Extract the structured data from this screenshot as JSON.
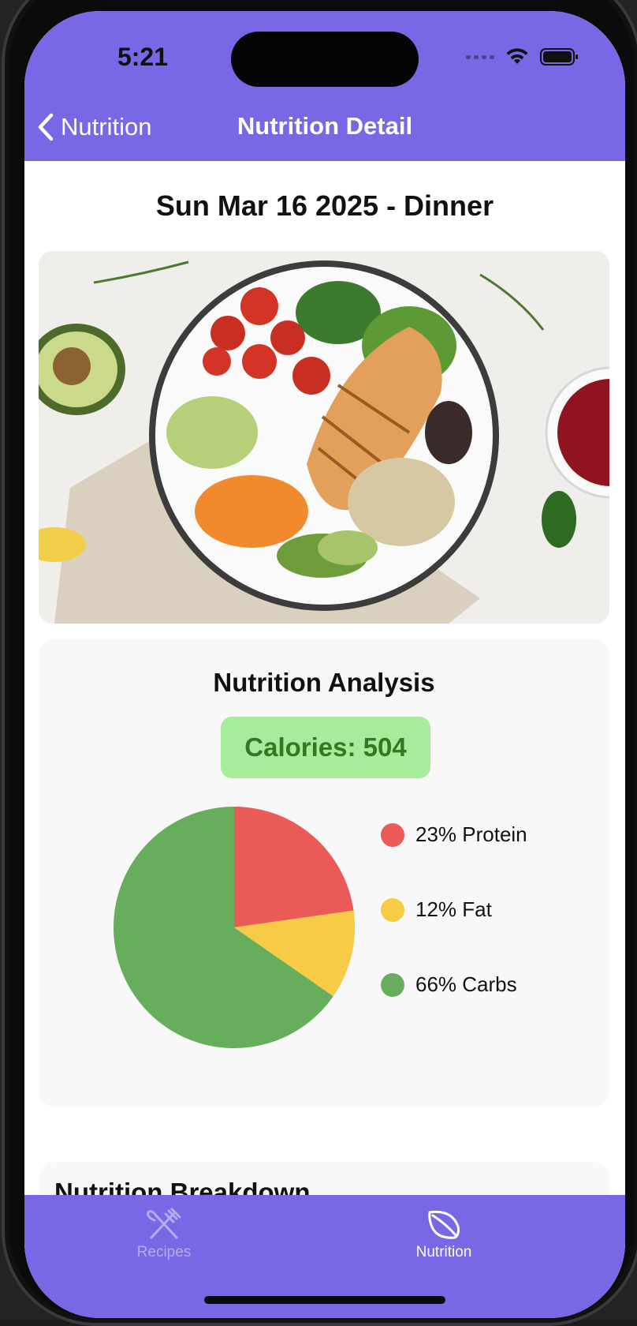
{
  "status_bar": {
    "time": "5:21"
  },
  "nav": {
    "back_label": "Nutrition",
    "title": "Nutrition Detail"
  },
  "meal": {
    "heading": "Sun Mar 16 2025 - Dinner"
  },
  "analysis": {
    "title": "Nutrition Analysis",
    "calories_label": "Calories: 504",
    "legend": [
      {
        "label": "23% Protein",
        "color": "#ea5b57"
      },
      {
        "label": "12% Fat",
        "color": "#f7cb45"
      },
      {
        "label": "66% Carbs",
        "color": "#67ae5c"
      }
    ]
  },
  "chart_data": {
    "type": "pie",
    "categories": [
      "Protein",
      "Fat",
      "Carbs"
    ],
    "values": [
      23,
      12,
      66
    ],
    "colors": [
      "#ea5b57",
      "#f7cb45",
      "#67ae5c"
    ]
  },
  "breakdown": {
    "title": "Nutrition Breakdown"
  },
  "tab_bar": {
    "tabs": [
      {
        "label": "Recipes",
        "icon": "fork-knife-icon",
        "active": false
      },
      {
        "label": "Nutrition",
        "icon": "leaf-icon",
        "active": true
      }
    ]
  },
  "colors": {
    "accent": "#7968e6",
    "calorie_badge_bg": "#a6ec9b",
    "calorie_badge_text": "#2f7a22"
  }
}
